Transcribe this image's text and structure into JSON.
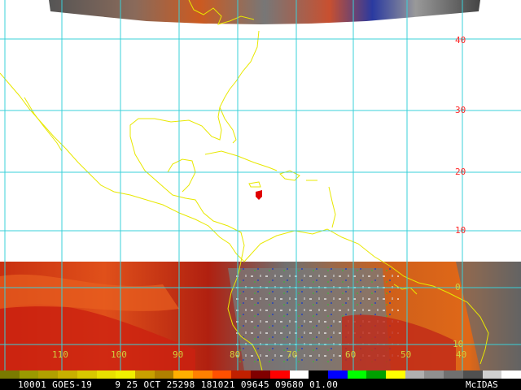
{
  "colors": {
    "grid": "#39d0d8",
    "coast": "#e8e800",
    "storm": "#e00000",
    "gridLabelLat": "#ff2a2a",
    "gridLabelLon": "#d0d040",
    "clear": "#ffffff"
  },
  "lat_labels": [
    "40",
    "30",
    "20",
    "10",
    "0",
    "10"
  ],
  "lon_labels": [
    "110",
    "100",
    "90",
    "80",
    "70",
    "60",
    "50",
    "40"
  ],
  "status": {
    "text": "10001 GOES-19    9 25 OCT 25298 181021 09645 09680 01.00",
    "signature": "McIDAS"
  },
  "colorbar": [
    "#7a7a00",
    "#9a9a00",
    "#b0a000",
    "#c8b000",
    "#d8c800",
    "#e8e000",
    "#f0f000",
    "#c8a000",
    "#b08000",
    "#ffb000",
    "#ff8000",
    "#ff5000",
    "#c02000",
    "#800000",
    "#ff0000",
    "#ffffff",
    "#000000",
    "#0000ff",
    "#00ff00",
    "#00a000",
    "#ffff00",
    "#b0b0b0",
    "#909090",
    "#707070",
    "#505050",
    "#d0d0d0",
    "#ffffff"
  ]
}
